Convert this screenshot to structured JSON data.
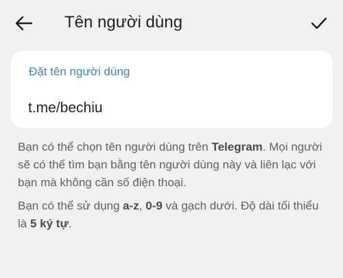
{
  "app_bar": {
    "title": "Tên người dùng",
    "back_icon": "arrow-left-icon",
    "confirm_icon": "check-icon"
  },
  "username_field": {
    "label": "Đặt tên người dùng",
    "value": "t.me/bechiu"
  },
  "help": {
    "p1_a": "Bạn có thể chọn tên người dùng trên ",
    "p1_b": "Telegram",
    "p1_c": ". Mọi người sẽ có thể tìm bạn bằng tên người dùng này và liên lạc với bạn mà không cần số điện thoại.",
    "p2_a": "Bạn có thể sử dụng ",
    "p2_b": "a-z",
    "p2_c": ", ",
    "p2_d": "0-9",
    "p2_e": " và gạch dưới. Độ dài tối thiểu là ",
    "p2_f": "5 ký tự",
    "p2_g": "."
  },
  "colors": {
    "background": "#f1f1f1",
    "card": "#ffffff",
    "accent": "#3a85b8",
    "text_primary": "#1f1f1f",
    "text_secondary": "#5e5e5e"
  }
}
